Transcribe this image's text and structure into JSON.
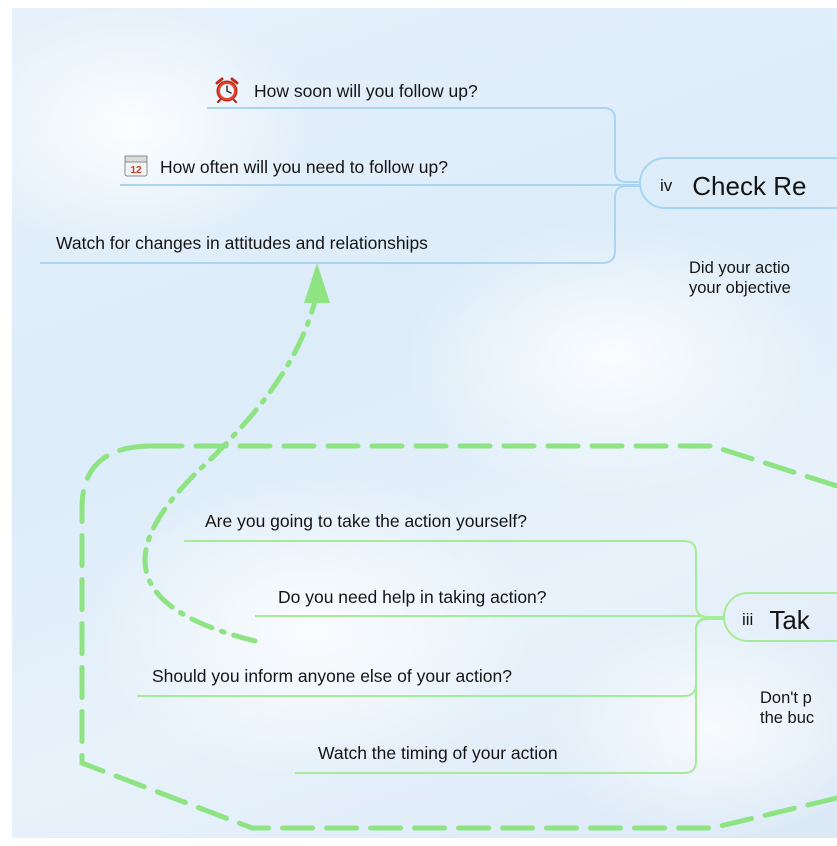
{
  "branch_iv": {
    "number": "iv",
    "title": "Check Re",
    "note_line1": "Did your actio",
    "note_line2": "your objective",
    "subtopics": [
      {
        "label": "How soon will you follow up?",
        "icon": "alarm-clock-icon"
      },
      {
        "label": "How often will you need to follow up?",
        "icon": "calendar-icon",
        "icon_text": "12"
      },
      {
        "label": "Watch for changes in attitudes and relationships"
      }
    ]
  },
  "branch_iii": {
    "number": "iii",
    "title": "Tak",
    "note_line1": "Don't p",
    "note_line2": "the buc",
    "subtopics": [
      {
        "label": "Are you going to take the action yourself?"
      },
      {
        "label": "Do you need help in taking action?"
      },
      {
        "label": "Should you inform anyone else of your action?"
      },
      {
        "label": "Watch the timing of your action"
      }
    ]
  },
  "colors": {
    "blue_branch": "#a9d4f2",
    "green_branch": "#a6ec98",
    "green_boundary": "#8ee382",
    "relationship_arrow": "#8ee382"
  }
}
